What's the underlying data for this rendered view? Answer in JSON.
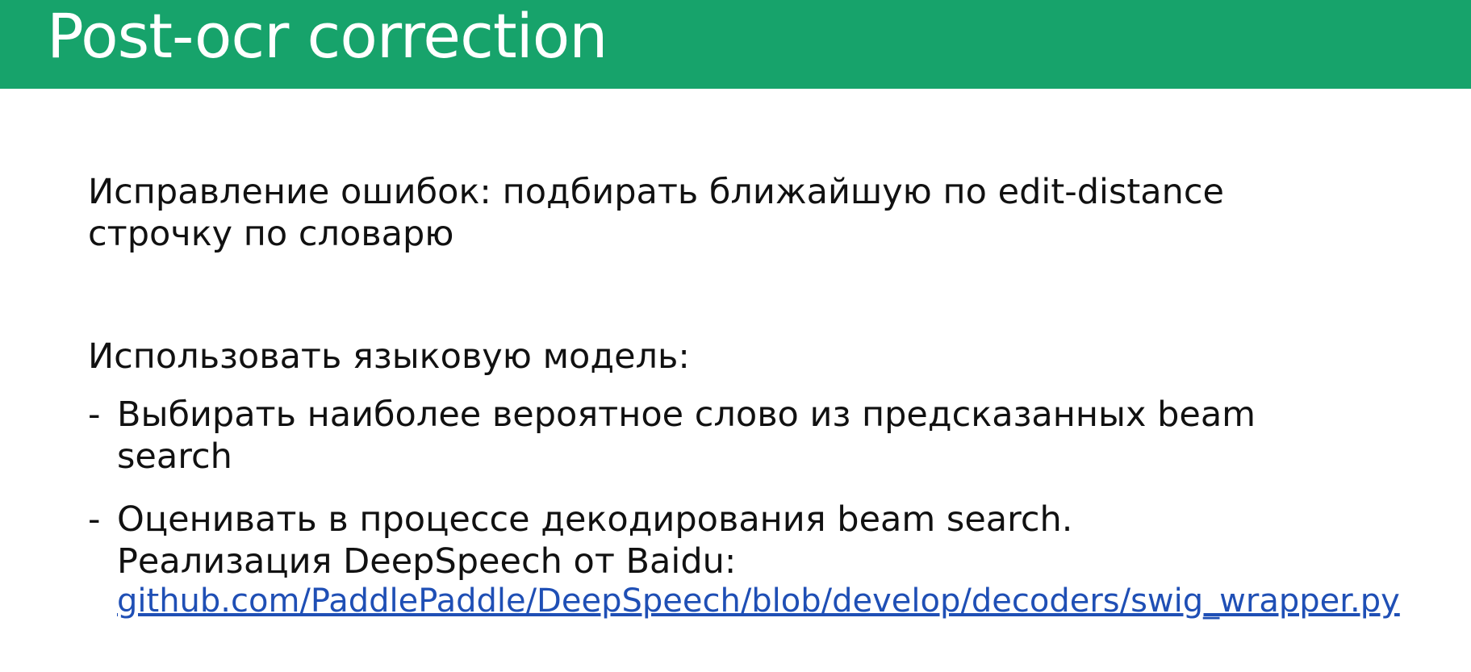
{
  "header": {
    "title": "Post-ocr correction"
  },
  "content": {
    "paragraph1": {
      "line1": "Исправление ошибок: подбирать ближайшую по edit-distance",
      "line2": "строчку по словарю"
    },
    "paragraph2": "Использовать языковую модель:",
    "bullets": [
      {
        "dash": "-",
        "line1": "Выбирать наиболее вероятное слово из предсказанных beam",
        "line2": "search"
      },
      {
        "dash": "-",
        "line1": "Оценивать в процессе декодирования beam search.",
        "line2": "Реализация DeepSpeech от Baidu:",
        "link": "github.com/PaddlePaddle/DeepSpeech/blob/develop/decoders/swig_wrapper.py"
      }
    ]
  },
  "colors": {
    "header_bg": "#17a36b",
    "title_text": "#ffffff",
    "body_text": "#111111",
    "link": "#1f4fb5"
  }
}
